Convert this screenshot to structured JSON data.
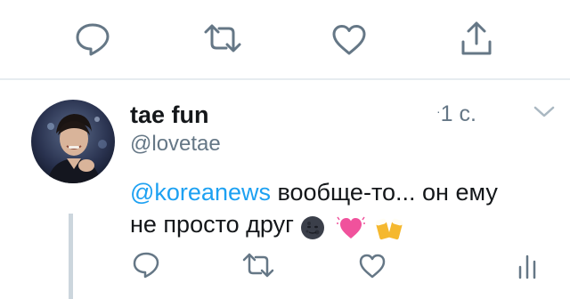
{
  "top_actions": {
    "reply_icon": "speech-bubble-icon",
    "retweet_icon": "retweet-icon",
    "like_icon": "heart-icon",
    "share_icon": "share-upload-icon"
  },
  "reply": {
    "display_name": "tae fun",
    "handle": "@lovetae",
    "timestamp": "1 с.",
    "text_mention": "@koreanews",
    "text_line1_rest": " вообще-то... он ему",
    "text_line2": "не просто друг",
    "emojis": [
      "new-moon-face-emoji",
      "beating-heart-emoji",
      "clinking-beer-mugs-emoji"
    ],
    "actions": {
      "reply_icon": "speech-bubble-icon",
      "retweet_icon": "retweet-icon",
      "like_icon": "heart-icon",
      "analytics_icon": "analytics-bars-icon"
    }
  },
  "colors": {
    "icon_gray": "#657786",
    "mention_blue": "#1da1f2",
    "text": "#14171a",
    "divider": "#e6ecf0",
    "thread_line": "#ccd6dd"
  }
}
